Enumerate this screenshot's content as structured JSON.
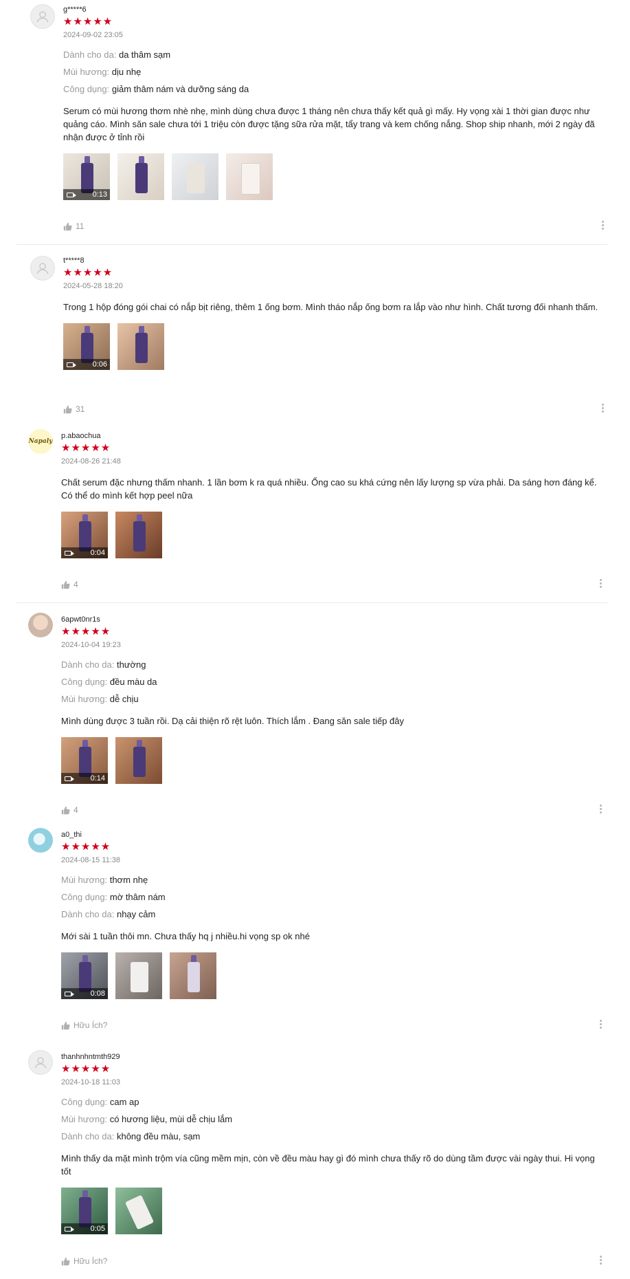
{
  "colors": {
    "star": "#d0011b",
    "label": "#999999",
    "time": "#888888"
  },
  "helpful_label": "Hữu Ích?",
  "reviews": [
    {
      "username": "g*****6",
      "stars": "★★★★★",
      "time": "2024-09-02 23:05",
      "attributes": [
        {
          "label": "Dành cho da:",
          "value": "da thâm sạm"
        },
        {
          "label": "Mùi hương:",
          "value": "dịu nhẹ"
        },
        {
          "label": "Công dụng:",
          "value": "giảm thâm nám và dưỡng sáng da"
        }
      ],
      "comment": "Serum có mùi hương thơm nhè nhẹ, mình dùng chưa được 1 tháng nên chưa thấy kết quả gì mấy. Hy vọng xài 1 thời gian được như quảng cáo. Mình săn sale chưa tới 1 triệu còn được tặng sữa rửa mặt, tẩy trang và kem chống nắng. Shop ship nhanh, mới 2 ngày đã nhận được ở tỉnh rồi",
      "video_duration": "0:13",
      "likes": "11"
    },
    {
      "username": "t*****8",
      "stars": "★★★★★",
      "time": "2024-05-28 18:20",
      "comment": "Trong 1 hộp đóng gói chai có nắp bịt riêng, thêm 1 ống bơm. Mình tháo nắp ống bơm ra lắp vào như hình. Chất tương đối nhanh thấm.",
      "video_duration": "0:06",
      "likes": "31"
    },
    {
      "username": "p.abaochua",
      "avatar_text": "Napaly",
      "stars": "★★★★★",
      "time": "2024-08-26 21:48",
      "comment": "Chất serum đặc nhưng thấm nhanh. 1 lần bơm k ra quá nhiều. Ống cao su khá cứng nên lấy lượng sp vừa phải. Da sáng hơn đáng kể. Có thể do mình kết hợp peel nữa",
      "video_duration": "0:04",
      "likes": "4"
    },
    {
      "username": "6apwt0nr1s",
      "stars": "★★★★★",
      "time": "2024-10-04 19:23",
      "attributes": [
        {
          "label": "Dành cho da:",
          "value": "thường"
        },
        {
          "label": "Công dụng:",
          "value": "đều màu da"
        },
        {
          "label": "Mùi hương:",
          "value": "dễ chịu"
        }
      ],
      "comment": "Mình dùng được 3 tuần rồi. Dạ cải thiện rõ rệt luôn. Thích lắm . Đang săn sale tiếp đây",
      "video_duration": "0:14",
      "likes": "4"
    },
    {
      "username": "a0_thi",
      "stars": "★★★★★",
      "time": "2024-08-15 11:38",
      "attributes": [
        {
          "label": "Mùi hương:",
          "value": "thơm nhẹ"
        },
        {
          "label": "Công dụng:",
          "value": "mờ thâm nám"
        },
        {
          "label": "Dành cho da:",
          "value": "nhạy cảm"
        }
      ],
      "comment": "Mới sài 1 tuần thôi mn. Chưa thấy hq j nhiều.hi vọng sp ok nhé",
      "video_duration": "0:08"
    },
    {
      "username": "thanhnhntmth929",
      "stars": "★★★★★",
      "time": "2024-10-18 11:03",
      "attributes": [
        {
          "label": "Công dụng:",
          "value": "cam ap"
        },
        {
          "label": "Mùi hương:",
          "value": "có hương liệu, mùi dễ chịu lắm"
        },
        {
          "label": "Dành cho da:",
          "value": "không đều màu, sạm"
        }
      ],
      "comment": "Mình thấy da mặt mình trộm vía cũng mềm mịn, còn về đều màu hay gì đó mình chưa thấy rõ do dùng tầm được vài ngày thui. Hi vọng tốt",
      "video_duration": "0:05"
    }
  ]
}
